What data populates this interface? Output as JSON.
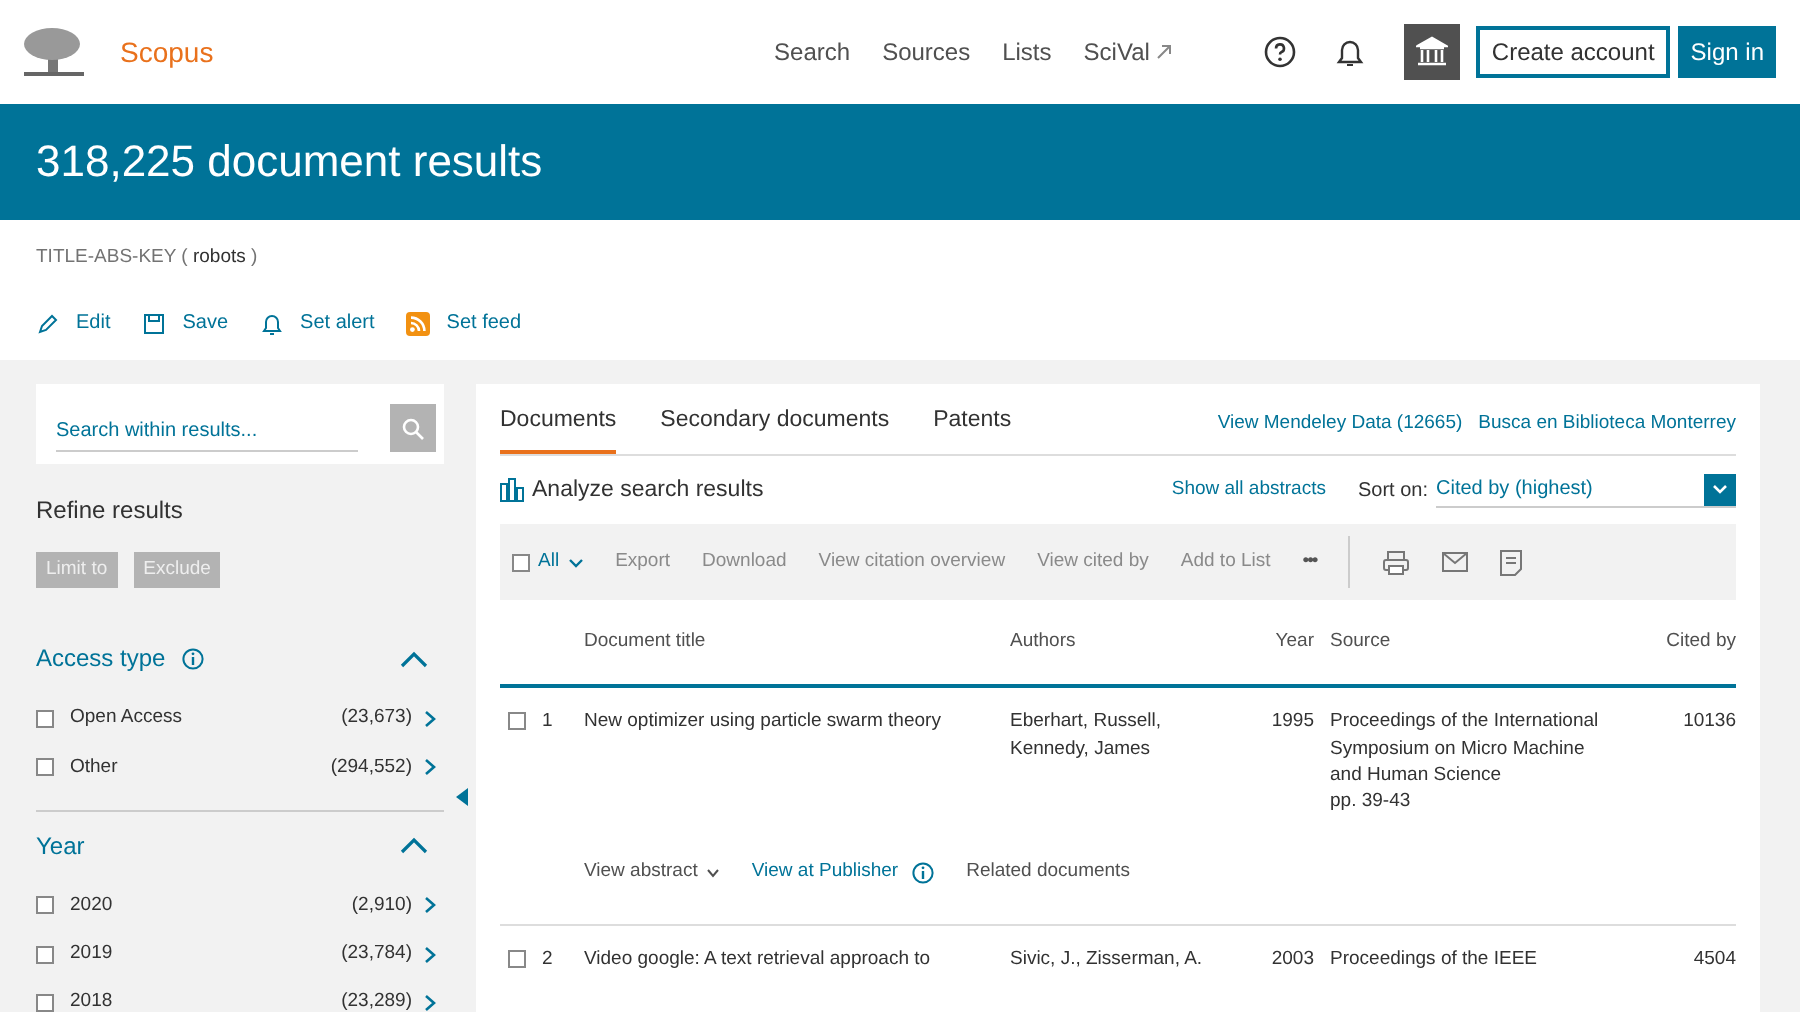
{
  "header": {
    "logo_text": "Scopus",
    "nav": [
      {
        "label": "Search",
        "external": false
      },
      {
        "label": "Sources",
        "external": false
      },
      {
        "label": "Lists",
        "external": false
      },
      {
        "label": "SciVal",
        "external": true
      }
    ],
    "create_account": "Create account",
    "sign_in": "Sign in"
  },
  "banner": {
    "title": "318,225 document results"
  },
  "query": "TITLE-ABS-KEY ( **robots** )",
  "query_actions": [
    "Edit",
    "Save",
    "Set alert",
    "Set feed"
  ],
  "sidebar": {
    "search_placeholder": "Search within results...",
    "refine_title": "Refine results",
    "refine_buttons": [
      {
        "label": "Limit to",
        "disabled": true
      },
      {
        "label": "Exclude",
        "disabled": true
      }
    ],
    "facets": [
      {
        "title": "Access type",
        "info": true,
        "expanded": true,
        "options": [
          {
            "label": "Open Access",
            "count": "(23,673)",
            "checked": false
          },
          {
            "label": "Other",
            "count": "(294,552)",
            "checked": false
          }
        ]
      },
      {
        "title": "Year",
        "info": false,
        "expanded": true,
        "options": [
          {
            "label": "2020",
            "count": "(2,910)",
            "checked": false
          },
          {
            "label": "2019",
            "count": "(23,784)",
            "checked": false
          },
          {
            "label": "2018",
            "count": "(23,289)",
            "checked": false
          }
        ]
      }
    ]
  },
  "results": {
    "tabs": [
      {
        "label": "Documents",
        "selected": true
      },
      {
        "label": "Secondary documents",
        "selected": false
      },
      {
        "label": "Patents",
        "selected": false
      }
    ],
    "links": [
      "View Mendeley Data (12665)",
      "Busca en Biblioteca Monterrey"
    ],
    "analyze": "Analyze search results",
    "show_all_abstracts": "Show all abstracts",
    "sort_label": "Sort on:",
    "sort_value": "Cited by (highest)",
    "select_all": {
      "label": "All",
      "checked": false
    },
    "toolbar_actions": [
      {
        "label": "Export",
        "disabled": true
      },
      {
        "label": "Download",
        "disabled": true
      },
      {
        "label": "View citation overview",
        "disabled": true
      },
      {
        "label": "View cited by",
        "disabled": true
      },
      {
        "label": "Add to List",
        "disabled": true
      }
    ],
    "more": "•••",
    "columns": [
      "Document title",
      "Authors",
      "Year",
      "Source",
      "Cited by"
    ],
    "rows": [
      {
        "number": "1",
        "checked": false,
        "title": "New optimizer using particle swarm theory",
        "authors": "Eberhart, Russell, Kennedy, James",
        "year": "1995",
        "source": "Proceedings of the International Symposium on Micro Machine and Human Science",
        "pages": "pp. 39-43",
        "cited_by": "10136",
        "links": [
          {
            "label": "View abstract",
            "kind": "toggle"
          },
          {
            "label": "View at Publisher",
            "kind": "publisher"
          },
          {
            "label": "Related documents",
            "kind": "plain"
          }
        ]
      },
      {
        "number": "2",
        "checked": false,
        "title": "Video google: A text retrieval approach to",
        "authors": "Sivic, J., Zisserman, A.",
        "year": "2003",
        "source": "Proceedings of the IEEE",
        "cited_by": "4504"
      }
    ]
  }
}
